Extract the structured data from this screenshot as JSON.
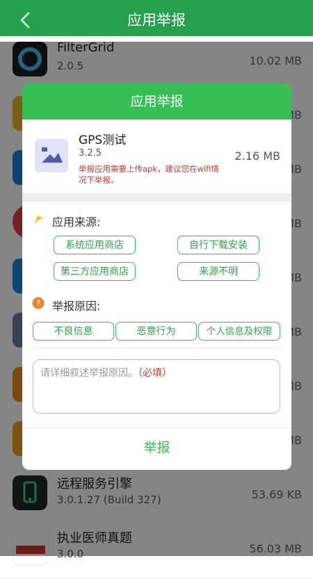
{
  "header": {
    "title": "应用举报"
  },
  "apps": [
    {
      "name": "FilterGrid",
      "version": "2.0.5",
      "size": "10.02 MB",
      "icon": "filtergrid-icon",
      "color": "#1f1f1f"
    },
    {
      "name": "",
      "version": "",
      "size": "MB",
      "icon": "app-icon-yellow",
      "color": "#f0b323"
    },
    {
      "name": "",
      "version": "",
      "size": "MB",
      "icon": "app-icon-blue",
      "color": "#1e7fd6"
    },
    {
      "name": "",
      "version": "",
      "size": "MB",
      "icon": "app-icon-red",
      "color": "#e04040"
    },
    {
      "name": "",
      "version": "",
      "size": "MB",
      "icon": "app-icon-blue2",
      "color": "#1a8ae0"
    },
    {
      "name": "",
      "version": "",
      "size": "MB",
      "icon": "app-icon-gray",
      "color": "#6c7fa8"
    },
    {
      "name": "",
      "version": "",
      "size": "MB",
      "icon": "app-icon-orange",
      "color": "#f08a1a"
    },
    {
      "name": "",
      "version": "",
      "size": "MB",
      "icon": "app-icon-orange2",
      "color": "#f0a020"
    },
    {
      "name": "远程服务引擎",
      "version": "3.0.1.27 (Build 327)",
      "size": "53.69 KB",
      "icon": "remote-service-icon",
      "color": "#1f2a2a"
    },
    {
      "name": "执业医师真题",
      "version": "3.0.0",
      "size": "56.03 MB",
      "icon": "medical-exam-icon",
      "color": "#d63030"
    }
  ],
  "dialog": {
    "title": "应用举报",
    "app": {
      "name": "GPS测试",
      "version": "3.2.5",
      "size": "2.16 MB",
      "warning": "举报应用需要上传apk，建议您在wifi情况下举报。"
    },
    "source": {
      "label": "应用来源:",
      "options": [
        "系统应用商店",
        "自行下载安装",
        "第三方应用商店",
        "来源不明"
      ]
    },
    "reason": {
      "label": "举报原因:",
      "options": [
        "不良信息",
        "恶意行为",
        "个人信息及权限"
      ]
    },
    "textarea": {
      "placeholder": "请详细叙述举报原因。",
      "required": "（必填）"
    },
    "submit": "举报"
  },
  "colors": {
    "header": "#24a14a",
    "accent": "#35bf55",
    "warning": "#c0392b"
  }
}
